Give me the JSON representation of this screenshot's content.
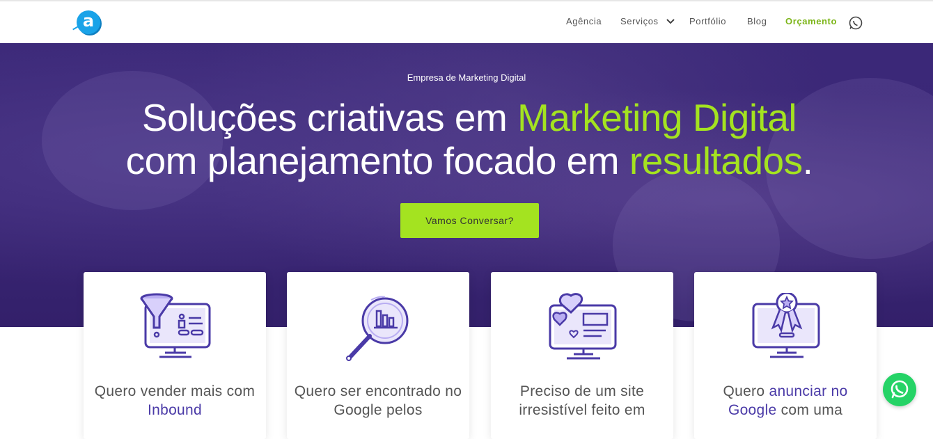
{
  "brand": {
    "logo_letter": "a"
  },
  "nav": {
    "items": [
      "Agência",
      "Serviços",
      "Portfólio",
      "Blog"
    ],
    "cta": "Orçamento"
  },
  "hero": {
    "eyebrow": "Empresa de Marketing Digital",
    "headline_part1": "Soluções criativas em ",
    "headline_hl1": "Marketing Digital",
    "headline_part2": "com planejamento focado em ",
    "headline_hl2": "resultados",
    "headline_end": ".",
    "button": "Vamos Conversar?"
  },
  "cards": [
    {
      "icon": "funnel-monitor-icon",
      "text_before": "Quero vender mais com ",
      "accent": "Inbound",
      "text_after": ""
    },
    {
      "icon": "magnifier-chart-icon",
      "text_before": "Quero ser encontrado no Google pelos",
      "accent": "",
      "text_after": ""
    },
    {
      "icon": "hearts-monitor-icon",
      "text_before": "Preciso de um site irresistível feito em",
      "accent": "",
      "text_after": ""
    },
    {
      "icon": "award-monitor-icon",
      "text_before": "Quero ",
      "accent": "anunciar no Google",
      "text_after": " com uma"
    }
  ],
  "colors": {
    "accent_green": "#a4e320",
    "hero_purple": "#3b2878",
    "icon_purple": "#4a3aa7",
    "logo_blue": "#1aa3e8",
    "whatsapp": "#25d366"
  }
}
